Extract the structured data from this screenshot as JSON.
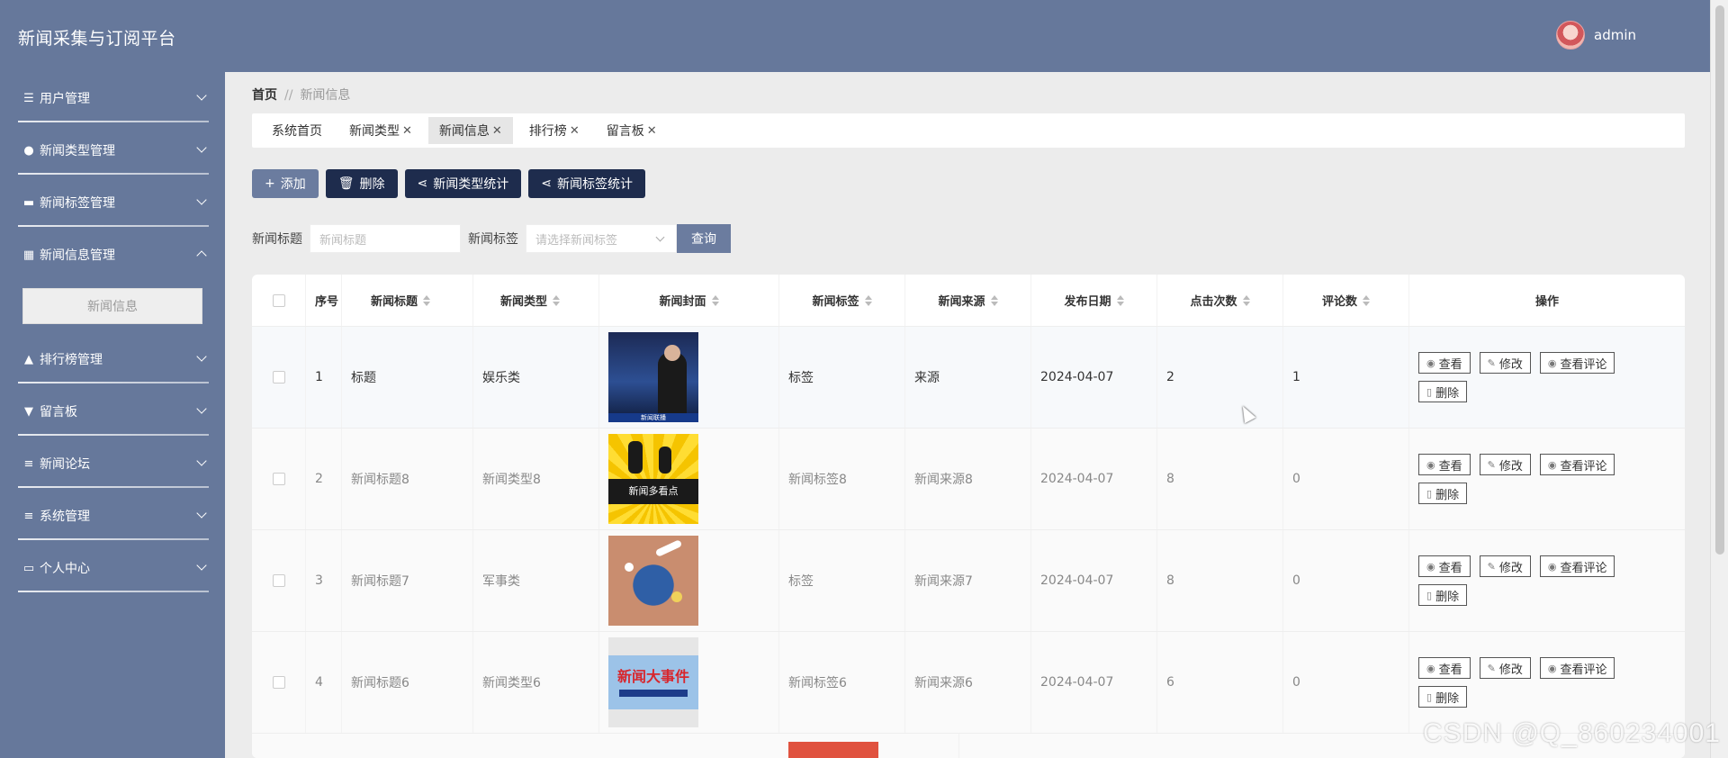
{
  "header": {
    "title": "新闻采集与订阅平台",
    "user": "admin"
  },
  "sidebar": {
    "items": [
      {
        "label": "用户管理",
        "icon": "sliders-icon"
      },
      {
        "label": "新闻类型管理",
        "icon": "person-icon"
      },
      {
        "label": "新闻标签管理",
        "icon": "monitor-icon"
      },
      {
        "label": "新闻信息管理",
        "icon": "grid-icon"
      },
      {
        "label": "排行榜管理",
        "icon": "thumbs-up-icon"
      },
      {
        "label": "留言板",
        "icon": "stamp-icon"
      },
      {
        "label": "新闻论坛",
        "icon": "list-icon"
      },
      {
        "label": "系统管理",
        "icon": "menu-icon"
      },
      {
        "label": "个人中心",
        "icon": "card-icon"
      }
    ],
    "submenu_active": "新闻信息"
  },
  "breadcrumb": {
    "home": "首页",
    "sep": "//",
    "current": "新闻信息"
  },
  "tabs": [
    {
      "label": "系统首页",
      "closable": false
    },
    {
      "label": "新闻类型",
      "closable": true
    },
    {
      "label": "新闻信息",
      "closable": true,
      "active": true
    },
    {
      "label": "排行榜",
      "closable": true
    },
    {
      "label": "留言板",
      "closable": true
    }
  ],
  "toolbar": {
    "add": "添加",
    "delete": "删除",
    "type_stats": "新闻类型统计",
    "tag_stats": "新闻标签统计"
  },
  "search": {
    "title_label": "新闻标题",
    "title_placeholder": "新闻标题",
    "tag_label": "新闻标签",
    "tag_placeholder": "请选择新闻标签",
    "query": "查询"
  },
  "table": {
    "columns": [
      "序号",
      "新闻标题",
      "新闻类型",
      "新闻封面",
      "新闻标签",
      "新闻来源",
      "发布日期",
      "点击次数",
      "评论数",
      "操作"
    ],
    "rows": [
      {
        "no": "1",
        "title": "标题",
        "type": "娱乐类",
        "tag": "标签",
        "source": "来源",
        "date": "2024-04-07",
        "clicks": "2",
        "comments": "1",
        "cover_text": "新闻联播"
      },
      {
        "no": "2",
        "title": "新闻标题8",
        "type": "新闻类型8",
        "tag": "新闻标签8",
        "source": "新闻来源8",
        "date": "2024-04-07",
        "clicks": "8",
        "comments": "0",
        "cover_text": "新闻多看点"
      },
      {
        "no": "3",
        "title": "新闻标题7",
        "type": "军事类",
        "tag": "标签",
        "source": "新闻来源7",
        "date": "2024-04-07",
        "clicks": "8",
        "comments": "0",
        "cover_text": ""
      },
      {
        "no": "4",
        "title": "新闻标题6",
        "type": "新闻类型6",
        "tag": "新闻标签6",
        "source": "新闻来源6",
        "date": "2024-04-07",
        "clicks": "6",
        "comments": "0",
        "cover_text": "新闻大事件"
      }
    ],
    "actions": {
      "view": "查看",
      "edit": "修改",
      "view_comments": "查看评论",
      "delete": "删除"
    }
  },
  "watermark": "CSDN @Q_860234001"
}
